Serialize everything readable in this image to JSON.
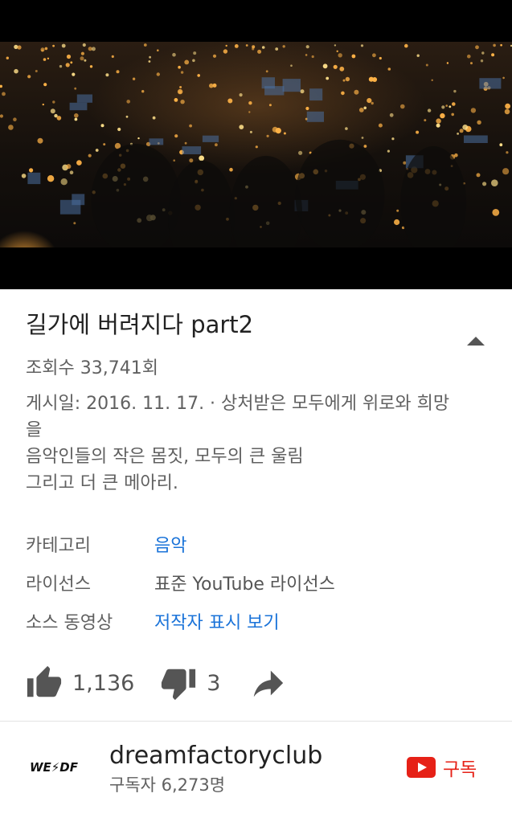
{
  "video": {
    "title": "길가에 버려지다 part2",
    "views": "조회수 33,741회",
    "description": "게시일: 2016. 11. 17. · 상처받은 모두에게 위로와 희망\n을\n음악인들의 작은 몸짓, 모두의 큰 울림\n그리고 더 큰 메아리."
  },
  "meta": [
    {
      "key": "카테고리",
      "value": "음악",
      "link": true
    },
    {
      "key": "라이선스",
      "value": "표준 YouTube 라이선스",
      "link": false
    },
    {
      "key": "소스 동영상",
      "value": "저작자 표시 보기",
      "link": true
    }
  ],
  "actions": {
    "likes": "1,136",
    "dislikes": "3",
    "icons": [
      "thumbs-up-icon",
      "thumbs-down-icon",
      "share-icon"
    ]
  },
  "channel": {
    "avatar_text": "WE⚡DF",
    "name": "dreamfactoryclub",
    "subscribers": "구독자 6,273명",
    "subscribe_label": "구독"
  },
  "colors": {
    "link": "#1a73d9",
    "subscribe": "#e62117",
    "secondary_text": "#606060"
  }
}
